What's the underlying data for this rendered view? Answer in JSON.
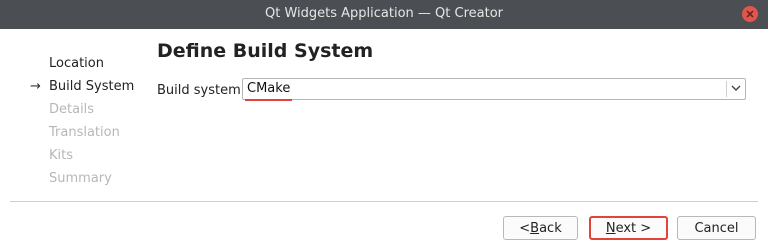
{
  "window": {
    "title": "Qt Widgets Application — Qt Creator"
  },
  "steps": [
    {
      "label": "Location"
    },
    {
      "label": "Build System"
    },
    {
      "label": "Details"
    },
    {
      "label": "Translation"
    },
    {
      "label": "Kits"
    },
    {
      "label": "Summary"
    }
  ],
  "current_step_marker": "→",
  "page": {
    "title": "Define Build System",
    "build_system_label": "Build system:",
    "build_system_value": "CMake"
  },
  "buttons": {
    "back": {
      "pre": "< ",
      "mnemonic": "B",
      "post": "ack"
    },
    "next": {
      "mnemonic": "N",
      "post": "ext >"
    },
    "cancel": "Cancel"
  },
  "colors": {
    "titlebar": "#4b4f54",
    "highlight": "#e0443d",
    "close": "#e2554d"
  },
  "icons": {
    "close": "close-icon",
    "dropdown": "chevron-down-icon",
    "current_step": "arrow-right-icon"
  }
}
